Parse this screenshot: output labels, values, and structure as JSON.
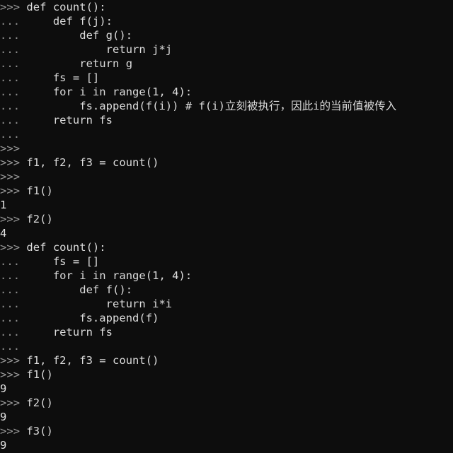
{
  "console": {
    "background_color": "#0d0d0d",
    "text_color": "#d8d8d8",
    "prompt_color": "#9a9a9a",
    "prompt_primary": ">>>",
    "prompt_continuation": "...",
    "lines": [
      {
        "type": "input",
        "marker": ">>>",
        "text": " def count():"
      },
      {
        "type": "input",
        "marker": "...",
        "text": "     def f(j):"
      },
      {
        "type": "input",
        "marker": "...",
        "text": "         def g():"
      },
      {
        "type": "input",
        "marker": "...",
        "text": "             return j*j"
      },
      {
        "type": "input",
        "marker": "...",
        "text": "         return g"
      },
      {
        "type": "input",
        "marker": "...",
        "text": "     fs = []"
      },
      {
        "type": "input",
        "marker": "...",
        "text": "     for i in range(1, 4):"
      },
      {
        "type": "input",
        "marker": "...",
        "text": "         fs.append(f(i)) # f(i)立刻被执行，因此i的当前值被传入"
      },
      {
        "type": "input",
        "marker": "...",
        "text": "     return fs"
      },
      {
        "type": "input",
        "marker": "...",
        "text": ""
      },
      {
        "type": "input",
        "marker": ">>>",
        "text": ""
      },
      {
        "type": "input",
        "marker": ">>>",
        "text": " f1, f2, f3 = count()"
      },
      {
        "type": "input",
        "marker": ">>>",
        "text": ""
      },
      {
        "type": "input",
        "marker": ">>>",
        "text": " f1()"
      },
      {
        "type": "output",
        "marker": "",
        "text": "1"
      },
      {
        "type": "input",
        "marker": ">>>",
        "text": " f2()"
      },
      {
        "type": "output",
        "marker": "",
        "text": "4"
      },
      {
        "type": "input",
        "marker": ">>>",
        "text": " def count():"
      },
      {
        "type": "input",
        "marker": "...",
        "text": "     fs = []"
      },
      {
        "type": "input",
        "marker": "...",
        "text": "     for i in range(1, 4):"
      },
      {
        "type": "input",
        "marker": "...",
        "text": "         def f():"
      },
      {
        "type": "input",
        "marker": "...",
        "text": "             return i*i"
      },
      {
        "type": "input",
        "marker": "...",
        "text": "         fs.append(f)"
      },
      {
        "type": "input",
        "marker": "...",
        "text": "     return fs"
      },
      {
        "type": "input",
        "marker": "...",
        "text": ""
      },
      {
        "type": "input",
        "marker": ">>>",
        "text": " f1, f2, f3 = count()"
      },
      {
        "type": "input",
        "marker": ">>>",
        "text": " f1()"
      },
      {
        "type": "output",
        "marker": "",
        "text": "9"
      },
      {
        "type": "input",
        "marker": ">>>",
        "text": " f2()"
      },
      {
        "type": "output",
        "marker": "",
        "text": "9"
      },
      {
        "type": "input",
        "marker": ">>>",
        "text": " f3()"
      },
      {
        "type": "output",
        "marker": "",
        "text": "9"
      }
    ]
  }
}
